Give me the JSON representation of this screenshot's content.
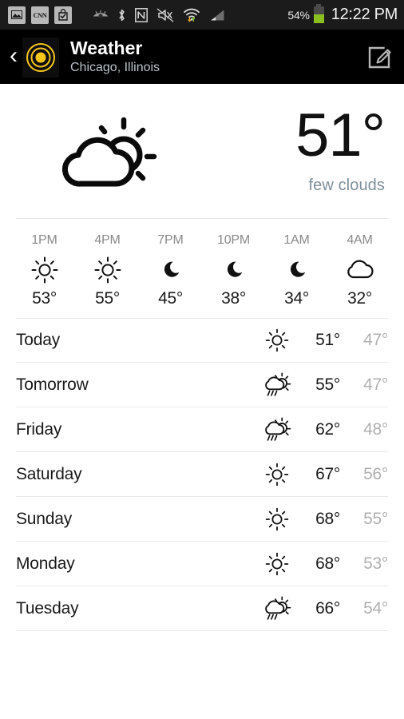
{
  "statusbar": {
    "notifications": [
      {
        "name": "gallery-image-icon",
        "label": ""
      },
      {
        "name": "cnn-news-icon",
        "label": "CNN"
      },
      {
        "name": "play-store-icon",
        "label": ""
      }
    ],
    "indicators": [
      {
        "name": "smart-stay-eye-icon"
      },
      {
        "name": "bluetooth-icon"
      },
      {
        "name": "nfc-icon"
      },
      {
        "name": "sound-mute-vibrate-icon"
      },
      {
        "name": "wifi-icon"
      },
      {
        "name": "cellular-signal-icon"
      }
    ],
    "battery_percent": "54%",
    "battery_level": 54,
    "battery_color": "#8bc020",
    "clock": "12:22 PM"
  },
  "actionbar": {
    "back_label": "‹",
    "app_icon": "weather-app-icon",
    "app_icon_color": "#f5c518",
    "title": "Weather",
    "subtitle": "Chicago, Illinois",
    "edit_action": "edit-location-icon"
  },
  "current": {
    "icon": "cloud-sun-icon",
    "temperature": "51°",
    "condition": "few clouds"
  },
  "hourly": [
    {
      "time": "1PM",
      "icon": "sun-icon",
      "temp": "53°"
    },
    {
      "time": "4PM",
      "icon": "sun-icon",
      "temp": "55°"
    },
    {
      "time": "7PM",
      "icon": "moon-icon",
      "temp": "45°"
    },
    {
      "time": "10PM",
      "icon": "moon-icon",
      "temp": "38°"
    },
    {
      "time": "1AM",
      "icon": "moon-icon",
      "temp": "34°"
    },
    {
      "time": "4AM",
      "icon": "cloud-icon",
      "temp": "32°"
    }
  ],
  "daily": [
    {
      "day": "Today",
      "icon": "sun-icon",
      "high": "51°",
      "low": "47°"
    },
    {
      "day": "Tomorrow",
      "icon": "rain-sun-cloud-icon",
      "high": "55°",
      "low": "47°"
    },
    {
      "day": "Friday",
      "icon": "rain-sun-cloud-icon",
      "high": "62°",
      "low": "48°"
    },
    {
      "day": "Saturday",
      "icon": "sun-icon",
      "high": "67°",
      "low": "56°"
    },
    {
      "day": "Sunday",
      "icon": "sun-icon",
      "high": "68°",
      "low": "55°"
    },
    {
      "day": "Monday",
      "icon": "sun-icon",
      "high": "68°",
      "low": "53°"
    },
    {
      "day": "Tuesday",
      "icon": "rain-sun-cloud-icon",
      "high": "66°",
      "low": "54°"
    }
  ]
}
